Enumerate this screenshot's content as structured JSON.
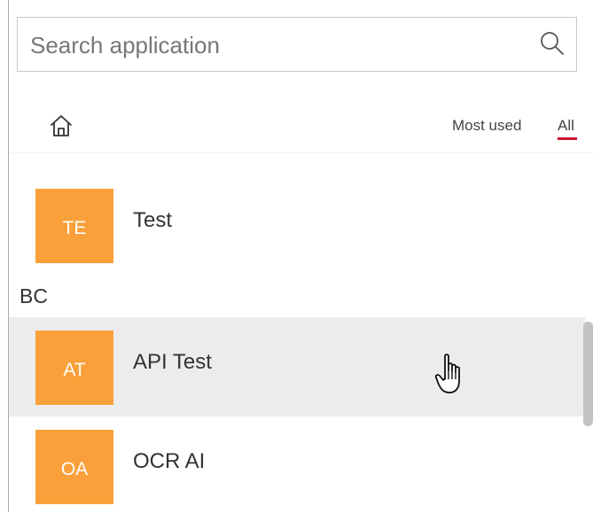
{
  "search": {
    "placeholder": "Search application",
    "value": "",
    "icon": "search-icon"
  },
  "nav": {
    "home_icon": "home-icon",
    "tabs": [
      {
        "label": "Most used",
        "active": false
      },
      {
        "label": "All",
        "active": true
      }
    ],
    "active_color": "#c8102e"
  },
  "apps": [
    {
      "initials": "TE",
      "name": "Test",
      "group": ""
    },
    {
      "initials": "AT",
      "name": "API Test",
      "group": "BC"
    },
    {
      "initials": "OA",
      "name": "OCR AI",
      "group": "BC"
    }
  ],
  "groups": [
    {
      "label": "BC"
    }
  ],
  "colors": {
    "tile": "#f9a03a",
    "hover_row": "#ececec"
  }
}
